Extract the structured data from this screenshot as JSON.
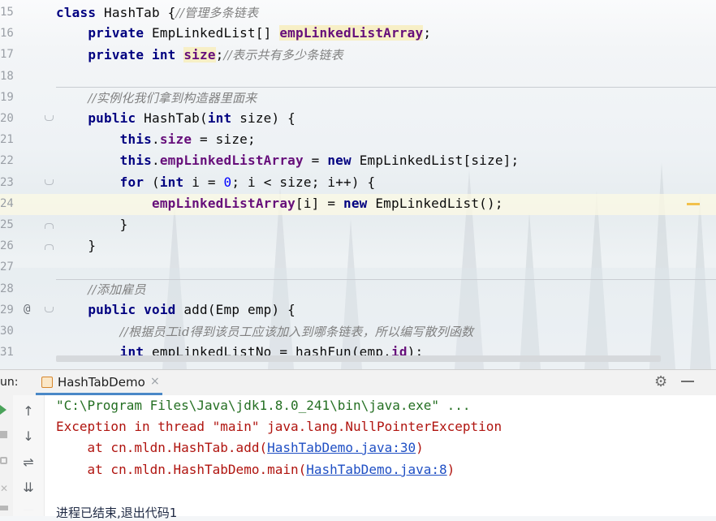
{
  "editor": {
    "lines": [
      {
        "num": "15",
        "fold": "",
        "tokens": [
          {
            "t": "class ",
            "c": "kw"
          },
          {
            "t": "HashTab {",
            "c": ""
          },
          {
            "t": "//管理多条链表",
            "c": "cm"
          }
        ]
      },
      {
        "num": "16",
        "fold": "",
        "tokens": [
          {
            "t": "    private ",
            "c": "kw"
          },
          {
            "t": "EmpLinkedList[] ",
            "c": ""
          },
          {
            "t": "empLinkedListArray",
            "c": "fld hl"
          },
          {
            "t": ";",
            "c": ""
          }
        ]
      },
      {
        "num": "17",
        "fold": "",
        "tokens": [
          {
            "t": "    private int ",
            "c": "kw"
          },
          {
            "t": "size",
            "c": "fld hl"
          },
          {
            "t": ";",
            "c": ""
          },
          {
            "t": "//表示共有多少条链表",
            "c": "cm"
          }
        ]
      },
      {
        "num": "18",
        "fold": "",
        "tokens": []
      },
      {
        "num": "19",
        "fold": "",
        "tokens": [
          {
            "t": "    ",
            "c": ""
          },
          {
            "t": "//实例化我们拿到构造器里面来",
            "c": "cm"
          }
        ]
      },
      {
        "num": "20",
        "fold": "top",
        "tokens": [
          {
            "t": "    public ",
            "c": "kw"
          },
          {
            "t": "HashTab(",
            "c": ""
          },
          {
            "t": "int ",
            "c": "kw"
          },
          {
            "t": "size) {",
            "c": ""
          }
        ]
      },
      {
        "num": "21",
        "fold": "",
        "tokens": [
          {
            "t": "        this",
            "c": "kw"
          },
          {
            "t": ".",
            "c": ""
          },
          {
            "t": "size",
            "c": "fld"
          },
          {
            "t": " = size;",
            "c": ""
          }
        ]
      },
      {
        "num": "22",
        "fold": "",
        "tokens": [
          {
            "t": "        this",
            "c": "kw"
          },
          {
            "t": ".",
            "c": ""
          },
          {
            "t": "empLinkedListArray",
            "c": "fld"
          },
          {
            "t": " = ",
            "c": ""
          },
          {
            "t": "new ",
            "c": "kw"
          },
          {
            "t": "EmpLinkedList[size];",
            "c": ""
          }
        ]
      },
      {
        "num": "23",
        "fold": "top",
        "tokens": [
          {
            "t": "        for ",
            "c": "kw"
          },
          {
            "t": "(",
            "c": ""
          },
          {
            "t": "int ",
            "c": "kw"
          },
          {
            "t": "i = ",
            "c": ""
          },
          {
            "t": "0",
            "c": "num"
          },
          {
            "t": "; i < size; i++) {",
            "c": ""
          }
        ]
      },
      {
        "num": "24",
        "fold": "",
        "current": true,
        "tokens": [
          {
            "t": "            ",
            "c": ""
          },
          {
            "t": "empLinkedListArray",
            "c": "fld"
          },
          {
            "t": "[i] = ",
            "c": ""
          },
          {
            "t": "new ",
            "c": "kw"
          },
          {
            "t": "EmpLinkedList();",
            "c": ""
          }
        ]
      },
      {
        "num": "25",
        "fold": "bot",
        "tokens": [
          {
            "t": "        }",
            "c": ""
          }
        ]
      },
      {
        "num": "26",
        "fold": "bot",
        "tokens": [
          {
            "t": "    }",
            "c": ""
          }
        ]
      },
      {
        "num": "27",
        "fold": "",
        "tokens": []
      },
      {
        "num": "28",
        "fold": "",
        "tokens": [
          {
            "t": "    ",
            "c": ""
          },
          {
            "t": "//添加雇员",
            "c": "cm"
          }
        ]
      },
      {
        "num": "29",
        "fold": "top",
        "at": "@",
        "tokens": [
          {
            "t": "    public void ",
            "c": "kw"
          },
          {
            "t": "add(Emp emp) {",
            "c": ""
          }
        ]
      },
      {
        "num": "30",
        "fold": "",
        "tokens": [
          {
            "t": "        ",
            "c": ""
          },
          {
            "t": "//根据员工id得到该员工应该加入到哪条链表，所以编写散列函数",
            "c": "cm"
          }
        ]
      },
      {
        "num": "31",
        "fold": "",
        "tokens": [
          {
            "t": "        int ",
            "c": "kw"
          },
          {
            "t": "empLinkedListNo = hashFun(emp.",
            "c": ""
          },
          {
            "t": "id",
            "c": "fld"
          },
          {
            "t": ");",
            "c": ""
          }
        ]
      }
    ]
  },
  "run_panel": {
    "label": "un:",
    "tab_title": "HashTabDemo",
    "tab_close": "×",
    "settings_icon": "gear-icon",
    "minimize_icon": "minimize-icon",
    "nav": {
      "up": "↑",
      "down": "↓",
      "wrap": "⇌",
      "scroll_end": "⇊"
    },
    "console": {
      "cmd": "\"C:\\Program Files\\Java\\jdk1.8.0_241\\bin\\java.exe\" ...",
      "exception": "Exception in thread \"main\" java.lang.NullPointerException",
      "trace1_prefix": "    at cn.mldn.HashTab.add(",
      "trace1_link": "HashTabDemo.java:30",
      "trace1_suffix": ")",
      "trace2_prefix": "    at cn.mldn.HashTabDemo.main(",
      "trace2_link": "HashTabDemo.java:8",
      "trace2_suffix": ")",
      "exit": "进程已结束,退出代码1"
    }
  },
  "colors": {
    "keyword": "#000080",
    "field": "#660e7a",
    "comment": "#808080",
    "error": "#b0140f",
    "command": "#246f22",
    "link": "#1f4fc4",
    "tab_accent": "#4a88c7"
  }
}
